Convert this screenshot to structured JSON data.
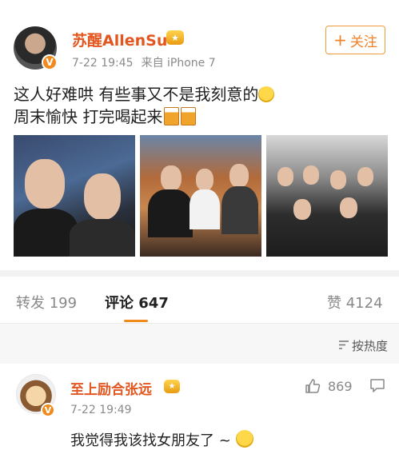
{
  "post": {
    "username": "苏醒AllenSu",
    "time": "7-22 19:45",
    "source": "来自 iPhone 7",
    "follow_label": "关注",
    "line1": "这人好难哄 有些事又不是我刻意的",
    "line2": "周末愉快 打完喝起来"
  },
  "tabs": {
    "repost_label": "转发",
    "repost_count": "199",
    "comment_label": "评论",
    "comment_count": "647",
    "like_label": "赞",
    "like_count": "4124"
  },
  "sort": {
    "label": "按热度"
  },
  "comment": {
    "username": "至上励合张远",
    "time": "7-22 19:49",
    "likes": "869",
    "text": "我觉得我该找女朋友了 ~"
  },
  "icons": [
    "verified-badge-icon",
    "crown-badge-icon",
    "plus-icon",
    "emoji-icon",
    "beer-icon",
    "sort-icon",
    "like-icon",
    "reply-icon"
  ],
  "colors": {
    "accent": "#f08a1c",
    "username": "#e3561f",
    "meta": "#8a8a8a"
  }
}
